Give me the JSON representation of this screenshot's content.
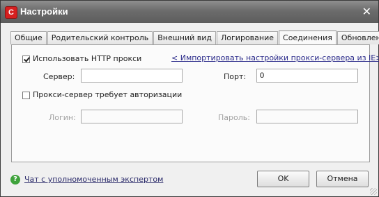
{
  "window": {
    "title": "Настройки",
    "app_icon_letter": "C"
  },
  "tabs": [
    {
      "label": "Общие"
    },
    {
      "label": "Родительский контроль"
    },
    {
      "label": "Внешний вид"
    },
    {
      "label": "Логирование"
    },
    {
      "label": "Соединения",
      "active": true
    },
    {
      "label": "Обновление"
    }
  ],
  "proxy": {
    "use_http_proxy_label": "Использовать HTTP прокси",
    "use_http_proxy_checked": true,
    "import_link": "< Импортировать настройки прокси-сервера из IE>",
    "server_label": "Сервер:",
    "server_value": "",
    "port_label": "Порт:",
    "port_value": "0",
    "auth_label": "Прокси-сервер требует авторизации",
    "auth_checked": false,
    "login_label": "Логин:",
    "login_value": "",
    "password_label": "Пароль:",
    "password_value": ""
  },
  "footer": {
    "expert_chat_link": "Чат с уполномоченным экспертом",
    "ok_label": "OK",
    "cancel_label": "Отмена"
  },
  "colors": {
    "titlebar": "#6c6c6c",
    "app_icon": "#d62020",
    "help_icon": "#3fa33c",
    "link": "#2a2a8a"
  },
  "icons": {
    "close": "close-icon",
    "help": "help-icon",
    "app": "comodo-icon"
  }
}
